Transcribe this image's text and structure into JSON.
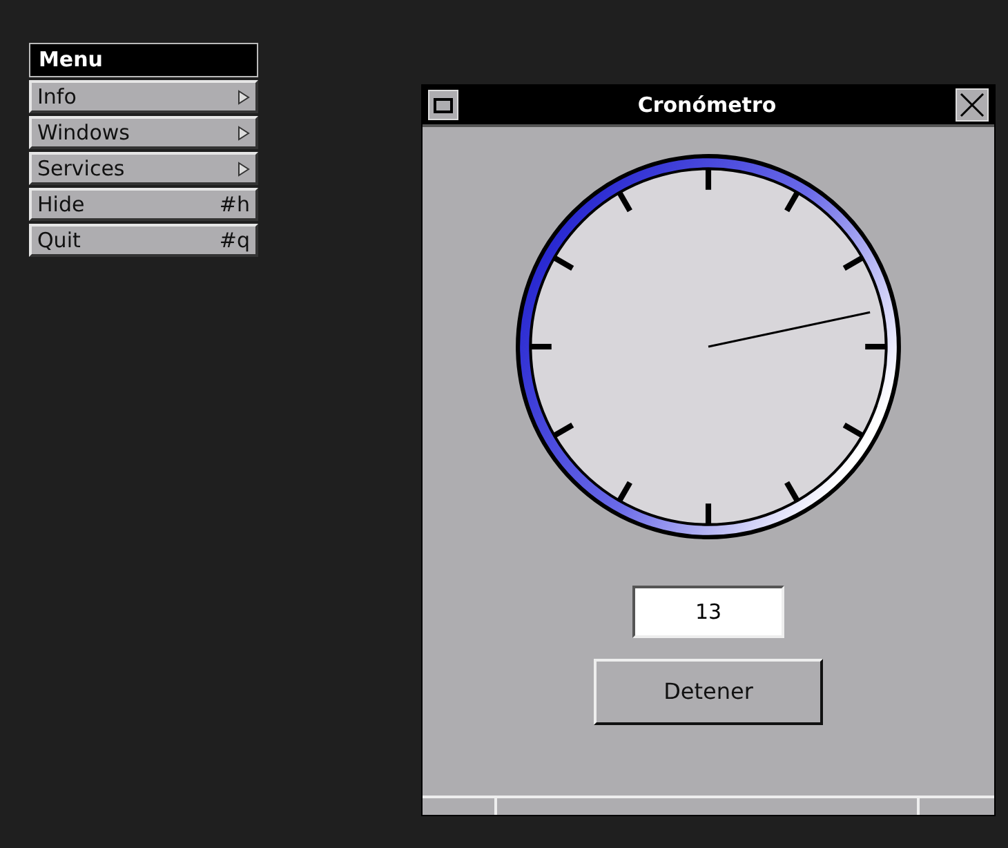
{
  "menu": {
    "title": "Menu",
    "items": [
      {
        "label": "Info",
        "kind": "submenu"
      },
      {
        "label": "Windows",
        "kind": "submenu"
      },
      {
        "label": "Services",
        "kind": "submenu"
      },
      {
        "label": "Hide",
        "kind": "shortcut",
        "shortcut": "#h"
      },
      {
        "label": "Quit",
        "kind": "shortcut",
        "shortcut": "#q"
      }
    ]
  },
  "window": {
    "title": "Cronómetro",
    "counter": "13",
    "button": "Detener"
  }
}
